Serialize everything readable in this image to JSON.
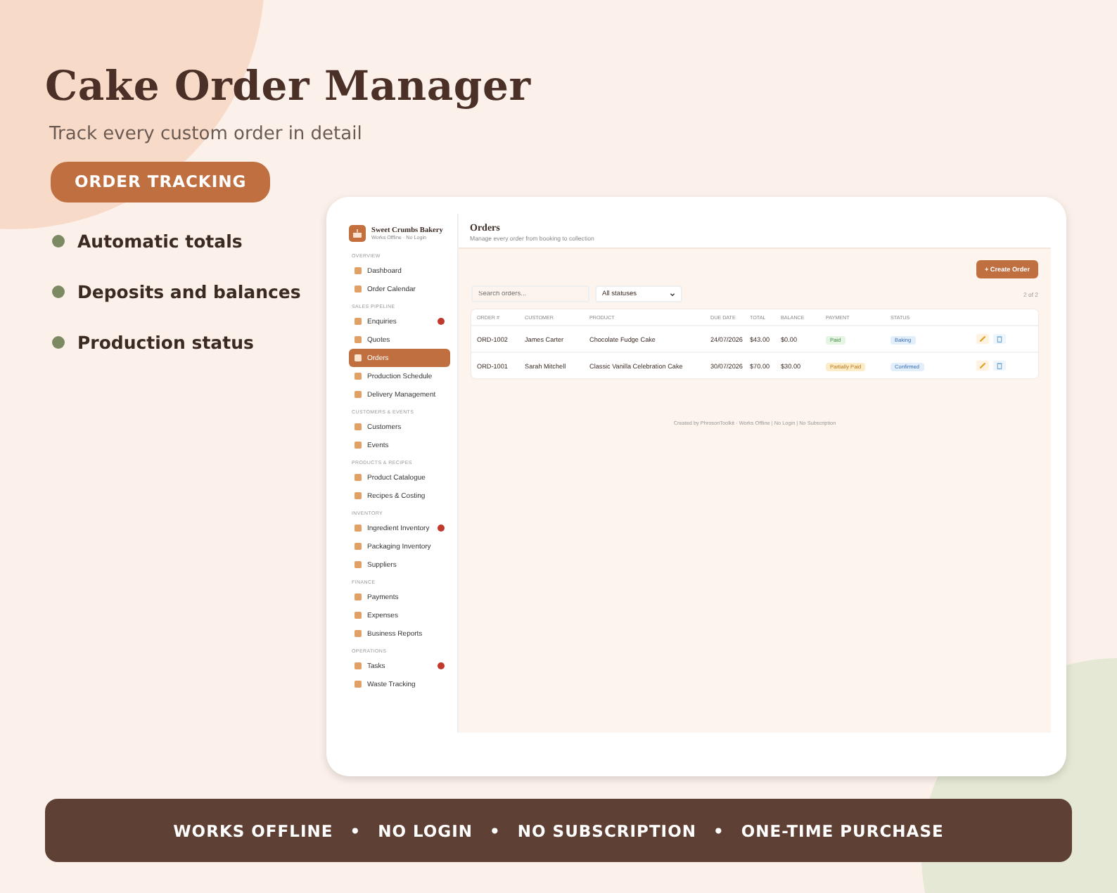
{
  "hero": {
    "title": "Cake Order Manager",
    "subtitle": "Track every custom order in detail",
    "tag": "ORDER TRACKING"
  },
  "features": [
    "Automatic totals",
    "Deposits and balances",
    "Production status"
  ],
  "app": {
    "brand": {
      "name": "Sweet Crumbs Bakery",
      "subtitle": "Works Offline · No Login"
    },
    "nav": [
      {
        "title": "OVERVIEW",
        "items": [
          {
            "label": "Dashboard",
            "selected": false,
            "badge": false
          },
          {
            "label": "Order Calendar",
            "selected": false,
            "badge": false
          }
        ]
      },
      {
        "title": "SALES PIPELINE",
        "items": [
          {
            "label": "Enquiries",
            "selected": false,
            "badge": true
          },
          {
            "label": "Quotes",
            "selected": false,
            "badge": false
          },
          {
            "label": "Orders",
            "selected": true,
            "badge": false
          },
          {
            "label": "Production Schedule",
            "selected": false,
            "badge": false
          },
          {
            "label": "Delivery Management",
            "selected": false,
            "badge": false
          }
        ]
      },
      {
        "title": "CUSTOMERS & EVENTS",
        "items": [
          {
            "label": "Customers",
            "selected": false,
            "badge": false
          },
          {
            "label": "Events",
            "selected": false,
            "badge": false
          }
        ]
      },
      {
        "title": "PRODUCTS & RECIPES",
        "items": [
          {
            "label": "Product Catalogue",
            "selected": false,
            "badge": false
          },
          {
            "label": "Recipes & Costing",
            "selected": false,
            "badge": false
          }
        ]
      },
      {
        "title": "INVENTORY",
        "items": [
          {
            "label": "Ingredient Inventory",
            "selected": false,
            "badge": true
          },
          {
            "label": "Packaging Inventory",
            "selected": false,
            "badge": false
          },
          {
            "label": "Suppliers",
            "selected": false,
            "badge": false
          }
        ]
      },
      {
        "title": "FINANCE",
        "items": [
          {
            "label": "Payments",
            "selected": false,
            "badge": false
          },
          {
            "label": "Expenses",
            "selected": false,
            "badge": false
          },
          {
            "label": "Business Reports",
            "selected": false,
            "badge": false
          }
        ]
      },
      {
        "title": "OPERATIONS",
        "items": [
          {
            "label": "Tasks",
            "selected": false,
            "badge": true
          },
          {
            "label": "Waste Tracking",
            "selected": false,
            "badge": false
          }
        ]
      }
    ],
    "page": {
      "title": "Orders",
      "subtitle": "Manage every order from booking to collection",
      "create_button": "+ Create Order",
      "search_placeholder": "Search orders...",
      "status_filter": "All statuses",
      "count": "2 of 2"
    },
    "columns": [
      "ORDER #",
      "CUSTOMER",
      "PRODUCT",
      "DUE DATE",
      "TOTAL",
      "BALANCE",
      "PAYMENT",
      "STATUS"
    ],
    "rows": [
      {
        "order": "ORD-1002",
        "customer": "James Carter",
        "product": "Chocolate Fudge Cake",
        "due": "24/07/2026",
        "total": "$43.00",
        "balance": "$0.00",
        "payment": {
          "label": "Paid",
          "kind": "paid"
        },
        "status": {
          "label": "Baking",
          "kind": "info"
        }
      },
      {
        "order": "ORD-1001",
        "customer": "Sarah Mitchell",
        "product": "Classic Vanilla Celebration Cake",
        "due": "30/07/2026",
        "total": "$70.00",
        "balance": "$30.00",
        "payment": {
          "label": "Partially Paid",
          "kind": "partial"
        },
        "status": {
          "label": "Confirmed",
          "kind": "info"
        }
      }
    ],
    "footer": "Created by PhrosonToolkit · Works Offline | No Login | No Subscription"
  },
  "banner": {
    "items": [
      "WORKS OFFLINE",
      "NO LOGIN",
      "NO SUBSCRIPTION",
      "ONE-TIME PURCHASE"
    ],
    "separator": "•"
  }
}
